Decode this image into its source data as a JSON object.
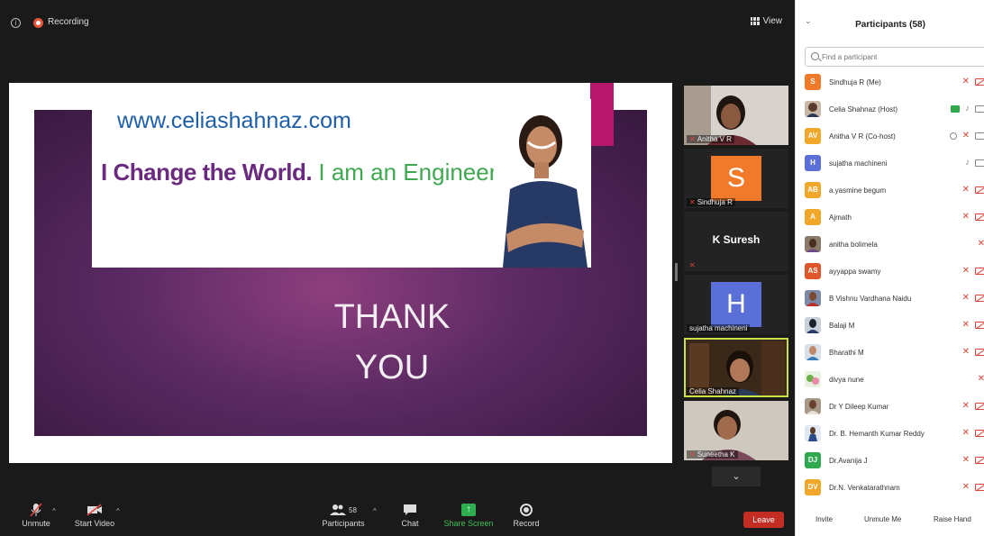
{
  "topbar": {
    "recording_label": "Recording",
    "view_label": "View"
  },
  "slide": {
    "url": "www.celiashahnaz.com",
    "tagline_strong": "I Change the World.",
    "tagline_light": "I am an Engineer.",
    "thank_line1": "THANK",
    "thank_line2": "YOU"
  },
  "thumbnails": [
    {
      "name": "Anitha V R",
      "type": "video"
    },
    {
      "name": "Sindhuja R",
      "type": "avatar",
      "initial": "S",
      "color": "#f07a2a"
    },
    {
      "name": "K Suresh",
      "type": "name"
    },
    {
      "name": "sujatha machineni",
      "type": "avatar",
      "initial": "H",
      "color": "#5a6fd8"
    },
    {
      "name": "Celia Shahnaz",
      "type": "video",
      "active": true
    },
    {
      "name": "Suneetha K",
      "type": "video"
    }
  ],
  "toolbar": {
    "unmute": "Unmute",
    "start_video": "Start Video",
    "participants": "Participants",
    "participants_count": "58",
    "chat": "Chat",
    "share_screen": "Share Screen",
    "record": "Record",
    "leave": "Leave"
  },
  "panel": {
    "title": "Participants (58)",
    "search_placeholder": "Find a participant",
    "participants": [
      {
        "name": "Sindhuja R (Me)",
        "initials": "S",
        "color": "#f07a2a"
      },
      {
        "name": "Celia Shahnaz (Host)",
        "photo": true
      },
      {
        "name": "Anitha V R (Co-host)",
        "initials": "AV",
        "color": "#f0a72a"
      },
      {
        "name": "sujatha machineni",
        "initials": "H",
        "color": "#5a6fd8"
      },
      {
        "name": "a.yasmine begum",
        "initials": "AB",
        "color": "#f0a72a"
      },
      {
        "name": "Ajmath",
        "initials": "A",
        "color": "#f0a72a"
      },
      {
        "name": "anitha bolimela",
        "photo": true
      },
      {
        "name": "ayyappa swamy",
        "initials": "AS",
        "color": "#e0562a"
      },
      {
        "name": "B Vishnu Vardhana Naidu",
        "photo": true
      },
      {
        "name": "Balaji M",
        "photo": true
      },
      {
        "name": "Bharathi M",
        "photo": true
      },
      {
        "name": "divya nune",
        "photo": true
      },
      {
        "name": "Dr Y  Dileep Kumar",
        "photo": true
      },
      {
        "name": "Dr. B. Hemanth Kumar Reddy",
        "photo": true
      },
      {
        "name": "Dr.Avanija J",
        "initials": "DJ",
        "color": "#2fa84f"
      },
      {
        "name": "Dr.N. Venkatarathnam",
        "initials": "DV",
        "color": "#f0a72a"
      }
    ],
    "footer": {
      "invite": "Invite",
      "unmute_me": "Unmute Me",
      "raise_hand": "Raise Hand"
    }
  }
}
